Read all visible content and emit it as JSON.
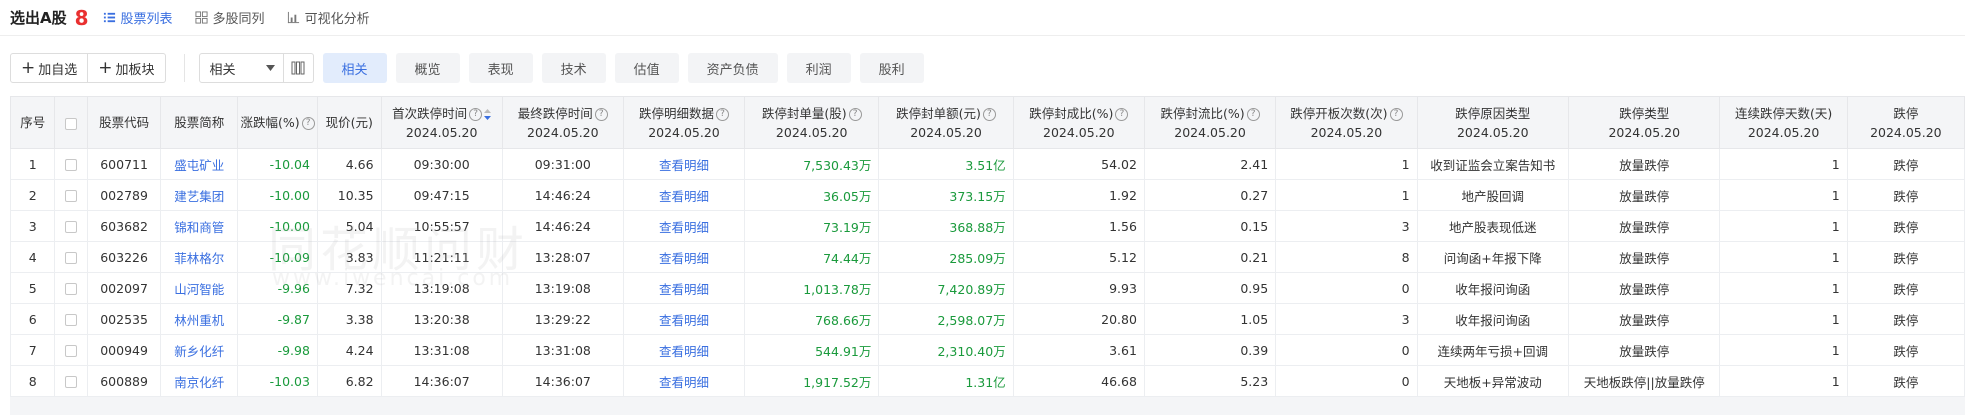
{
  "header": {
    "title": "选出A股",
    "count": "8",
    "view_tabs": [
      {
        "label": "股票列表",
        "active": true
      },
      {
        "label": "多股同列",
        "active": false
      },
      {
        "label": "可视化分析",
        "active": false
      }
    ]
  },
  "toolbar": {
    "add_watchlist": "加自选",
    "add_sector": "加板块",
    "select_value": "相关",
    "category_tabs": [
      "相关",
      "概览",
      "表现",
      "技术",
      "估值",
      "资产负债",
      "利润",
      "股利"
    ]
  },
  "table": {
    "columns": [
      {
        "title": "序号",
        "date": "",
        "help": false
      },
      {
        "title": "",
        "date": "",
        "help": false
      },
      {
        "title": "股票代码",
        "date": "",
        "help": false
      },
      {
        "title": "股票简称",
        "date": "",
        "help": false
      },
      {
        "title": "涨跌幅(%)",
        "date": "",
        "help": true
      },
      {
        "title": "现价(元)",
        "date": "",
        "help": false
      },
      {
        "title": "首次跌停时间",
        "date": "2024.05.20",
        "help": true
      },
      {
        "title": "最终跌停时间",
        "date": "2024.05.20",
        "help": true
      },
      {
        "title": "跌停明细数据",
        "date": "2024.05.20",
        "help": true
      },
      {
        "title": "跌停封单量(股)",
        "date": "2024.05.20",
        "help": true
      },
      {
        "title": "跌停封单额(元)",
        "date": "2024.05.20",
        "help": true
      },
      {
        "title": "跌停封成比(%)",
        "date": "2024.05.20",
        "help": true
      },
      {
        "title": "跌停封流比(%)",
        "date": "2024.05.20",
        "help": true
      },
      {
        "title": "跌停开板次数(次)",
        "date": "2024.05.20",
        "help": true
      },
      {
        "title": "跌停原因类型",
        "date": "2024.05.20",
        "help": false
      },
      {
        "title": "跌停类型",
        "date": "2024.05.20",
        "help": false
      },
      {
        "title": "连续跌停天数(天)",
        "date": "2024.05.20",
        "help": false
      },
      {
        "title": "跌停",
        "date": "2024.05.20",
        "help": false
      }
    ],
    "rows": [
      [
        "1",
        "600711",
        "盛屯矿业",
        "-10.04",
        "4.66",
        "09:30:00",
        "09:31:00",
        "查看明细",
        "7,530.43万",
        "3.51亿",
        "54.02",
        "2.41",
        "1",
        "收到证监会立案告知书",
        "放量跌停",
        "1",
        "跌停"
      ],
      [
        "2",
        "002789",
        "建艺集团",
        "-10.00",
        "10.35",
        "09:47:15",
        "14:46:24",
        "查看明细",
        "36.05万",
        "373.15万",
        "1.92",
        "0.27",
        "1",
        "地产股回调",
        "放量跌停",
        "1",
        "跌停"
      ],
      [
        "3",
        "603682",
        "锦和商管",
        "-10.00",
        "5.04",
        "10:55:57",
        "14:46:24",
        "查看明细",
        "73.19万",
        "368.88万",
        "1.56",
        "0.15",
        "3",
        "地产股表现低迷",
        "放量跌停",
        "1",
        "跌停"
      ],
      [
        "4",
        "603226",
        "菲林格尔",
        "-10.09",
        "3.83",
        "11:21:11",
        "13:28:07",
        "查看明细",
        "74.44万",
        "285.09万",
        "5.12",
        "0.21",
        "8",
        "问询函+年报下降",
        "放量跌停",
        "1",
        "跌停"
      ],
      [
        "5",
        "002097",
        "山河智能",
        "-9.96",
        "7.32",
        "13:19:08",
        "13:19:08",
        "查看明细",
        "1,013.78万",
        "7,420.89万",
        "9.93",
        "0.95",
        "0",
        "收年报问询函",
        "放量跌停",
        "1",
        "跌停"
      ],
      [
        "6",
        "002535",
        "林州重机",
        "-9.87",
        "3.38",
        "13:20:38",
        "13:29:22",
        "查看明细",
        "768.66万",
        "2,598.07万",
        "20.80",
        "1.05",
        "3",
        "收年报问询函",
        "放量跌停",
        "1",
        "跌停"
      ],
      [
        "7",
        "000949",
        "新乡化纤",
        "-9.98",
        "4.24",
        "13:31:08",
        "13:31:08",
        "查看明细",
        "544.91万",
        "2,310.40万",
        "3.61",
        "0.39",
        "0",
        "连续两年亏损+回调",
        "放量跌停",
        "1",
        "跌停"
      ],
      [
        "8",
        "600889",
        "南京化纤",
        "-10.03",
        "6.82",
        "14:36:07",
        "14:36:07",
        "查看明细",
        "1,917.52万",
        "1.31亿",
        "46.68",
        "5.23",
        "0",
        "天地板+异常波动",
        "天地板跌停||放量跌停",
        "1",
        "跌停"
      ]
    ]
  },
  "watermark": {
    "text": "同花顺问财",
    "sub": "www.iwencai.com"
  },
  "colors": {
    "accent": "#3a6fe0",
    "down": "#1a9a3c",
    "count": "#e93030"
  },
  "icons": [
    "list-icon",
    "grid-icon",
    "bar-chart-icon",
    "plus-icon",
    "chevron-down-icon",
    "columns-icon",
    "help-icon",
    "sort-icon",
    "checkbox-icon"
  ]
}
